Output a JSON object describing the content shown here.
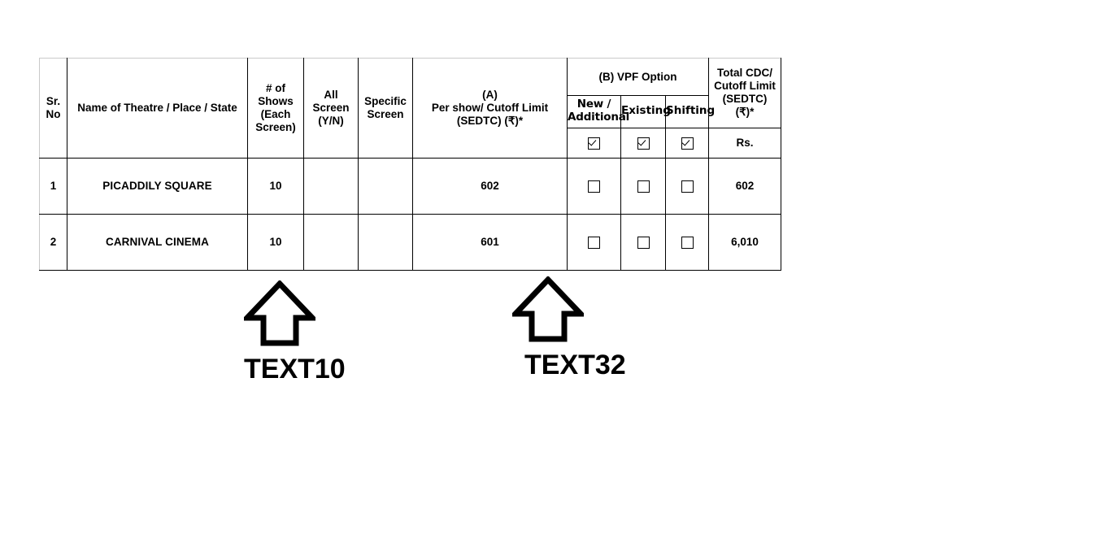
{
  "table": {
    "columns": {
      "sr_no": "Sr.\nNo",
      "sr_no_line1": "Sr.",
      "sr_no_line2": "No",
      "name": "Name of Theatre / Place / State",
      "shows_l1": "# of",
      "shows_l2": "Shows",
      "shows_l3": "(Each",
      "shows_l4": "Screen)",
      "all_screen_l1": "All",
      "all_screen_l2": "Screen",
      "all_screen_l3": "(Y/N)",
      "specific_l1": "Specific",
      "specific_l2": "Screen",
      "per_show_l1": "(A)",
      "per_show_l2": "Per show/ Cutoff Limit",
      "per_show_l3": "(SEDTC) (₹)*",
      "vpf_option": "(B) VPF Option",
      "vpf_new_l1": "New /",
      "vpf_new_l2": "Additional",
      "vpf_existing": "Existing",
      "vpf_shifting": "Shifting",
      "total_l1": "Total CDC/",
      "total_l2": "Cutoff Limit",
      "total_l3": "(SEDTC)",
      "total_l4": "(₹)*",
      "total_units": "Rs."
    },
    "header_checkboxes": {
      "new_additional": "checked",
      "existing": "checked",
      "shifting": "checked"
    },
    "rows": [
      {
        "sr_no": "1",
        "name": "PICADDILY SQUARE",
        "shows": "10",
        "all_screen": "",
        "specific_screen": "",
        "per_show": "602",
        "vpf_new": "unchecked",
        "vpf_existing": "unchecked",
        "vpf_shifting": "unchecked",
        "total": "602"
      },
      {
        "sr_no": "2",
        "name": "CARNIVAL CINEMA",
        "shows": "10",
        "all_screen": "",
        "specific_screen": "",
        "per_show": "601",
        "vpf_new": "unchecked",
        "vpf_existing": "unchecked",
        "vpf_shifting": "unchecked",
        "total": "6,010"
      }
    ]
  },
  "callouts": [
    {
      "label": "TEXT10",
      "points_to": "# of Shows (Each Screen)"
    },
    {
      "label": "TEXT32",
      "points_to": "(A) Per show/ Cutoff Limit (SEDTC)"
    }
  ],
  "colors": {
    "border": "#000000",
    "outer_border_light": "#c9c9c9",
    "text": "#000000",
    "background": "#ffffff"
  }
}
